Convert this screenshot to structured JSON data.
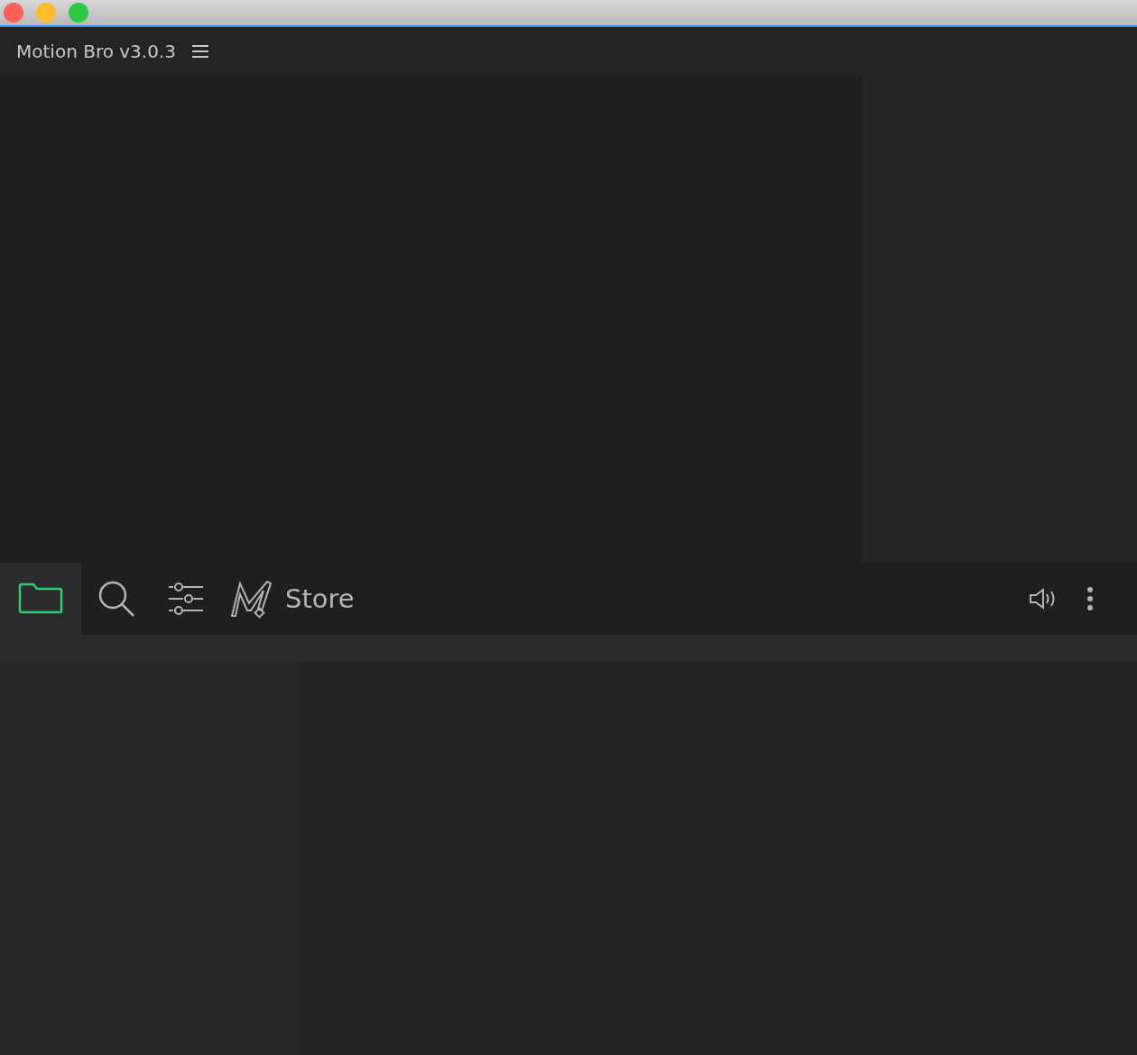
{
  "panel": {
    "title": "Motion Bro v3.0.3"
  },
  "toolbar": {
    "tabs": [
      {
        "kind": "folder",
        "selected": true
      },
      {
        "kind": "search",
        "selected": false
      },
      {
        "kind": "sliders",
        "selected": false
      },
      {
        "kind": "store",
        "selected": false,
        "label": "Store"
      }
    ],
    "actions": [
      {
        "kind": "volume"
      },
      {
        "kind": "more"
      }
    ]
  }
}
